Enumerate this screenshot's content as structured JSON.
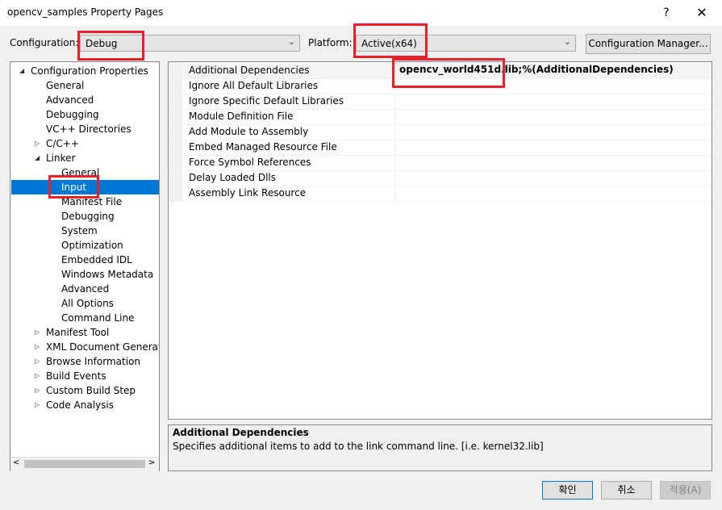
{
  "window": {
    "title": "opencv_samples Property Pages",
    "help": "?",
    "close": "✕"
  },
  "toolbar": {
    "configuration_label": "Configuration:",
    "configuration_value": "Debug",
    "platform_label": "Platform:",
    "platform_value": "Active(x64)",
    "config_manager_label": "Configuration Manager..."
  },
  "tree": {
    "items": [
      {
        "label": "Configuration Properties",
        "expander": "◢"
      },
      {
        "label": "General"
      },
      {
        "label": "Advanced"
      },
      {
        "label": "Debugging"
      },
      {
        "label": "VC++ Directories"
      },
      {
        "label": "C/C++",
        "expander": "▷"
      },
      {
        "label": "Linker",
        "expander": "◢"
      },
      {
        "label": "General"
      },
      {
        "label": "Input",
        "selected": true
      },
      {
        "label": "Manifest File"
      },
      {
        "label": "Debugging"
      },
      {
        "label": "System"
      },
      {
        "label": "Optimization"
      },
      {
        "label": "Embedded IDL"
      },
      {
        "label": "Windows Metadata"
      },
      {
        "label": "Advanced"
      },
      {
        "label": "All Options"
      },
      {
        "label": "Command Line"
      },
      {
        "label": "Manifest Tool",
        "expander": "▷"
      },
      {
        "label": "XML Document Generator",
        "expander": "▷"
      },
      {
        "label": "Browse Information",
        "expander": "▷"
      },
      {
        "label": "Build Events",
        "expander": "▷"
      },
      {
        "label": "Custom Build Step",
        "expander": "▷"
      },
      {
        "label": "Code Analysis",
        "expander": "▷"
      }
    ],
    "scroll_left": "<",
    "scroll_right": ">"
  },
  "grid": {
    "properties": [
      {
        "name": "Additional Dependencies",
        "value": "opencv_world451d.lib;%(AdditionalDependencies)"
      },
      {
        "name": "Ignore All Default Libraries",
        "value": ""
      },
      {
        "name": "Ignore Specific Default Libraries",
        "value": ""
      },
      {
        "name": "Module Definition File",
        "value": ""
      },
      {
        "name": "Add Module to Assembly",
        "value": ""
      },
      {
        "name": "Embed Managed Resource File",
        "value": ""
      },
      {
        "name": "Force Symbol References",
        "value": ""
      },
      {
        "name": "Delay Loaded Dlls",
        "value": ""
      },
      {
        "name": "Assembly Link Resource",
        "value": ""
      }
    ]
  },
  "description": {
    "title": "Additional Dependencies",
    "text": "Specifies additional items to add to the link command line. [i.e. kernel32.lib]"
  },
  "buttons": {
    "ok": "확인",
    "cancel": "취소",
    "apply": "적용(A)"
  },
  "colors": {
    "highlight": "#0078d7",
    "annotation": "#e8202a"
  }
}
